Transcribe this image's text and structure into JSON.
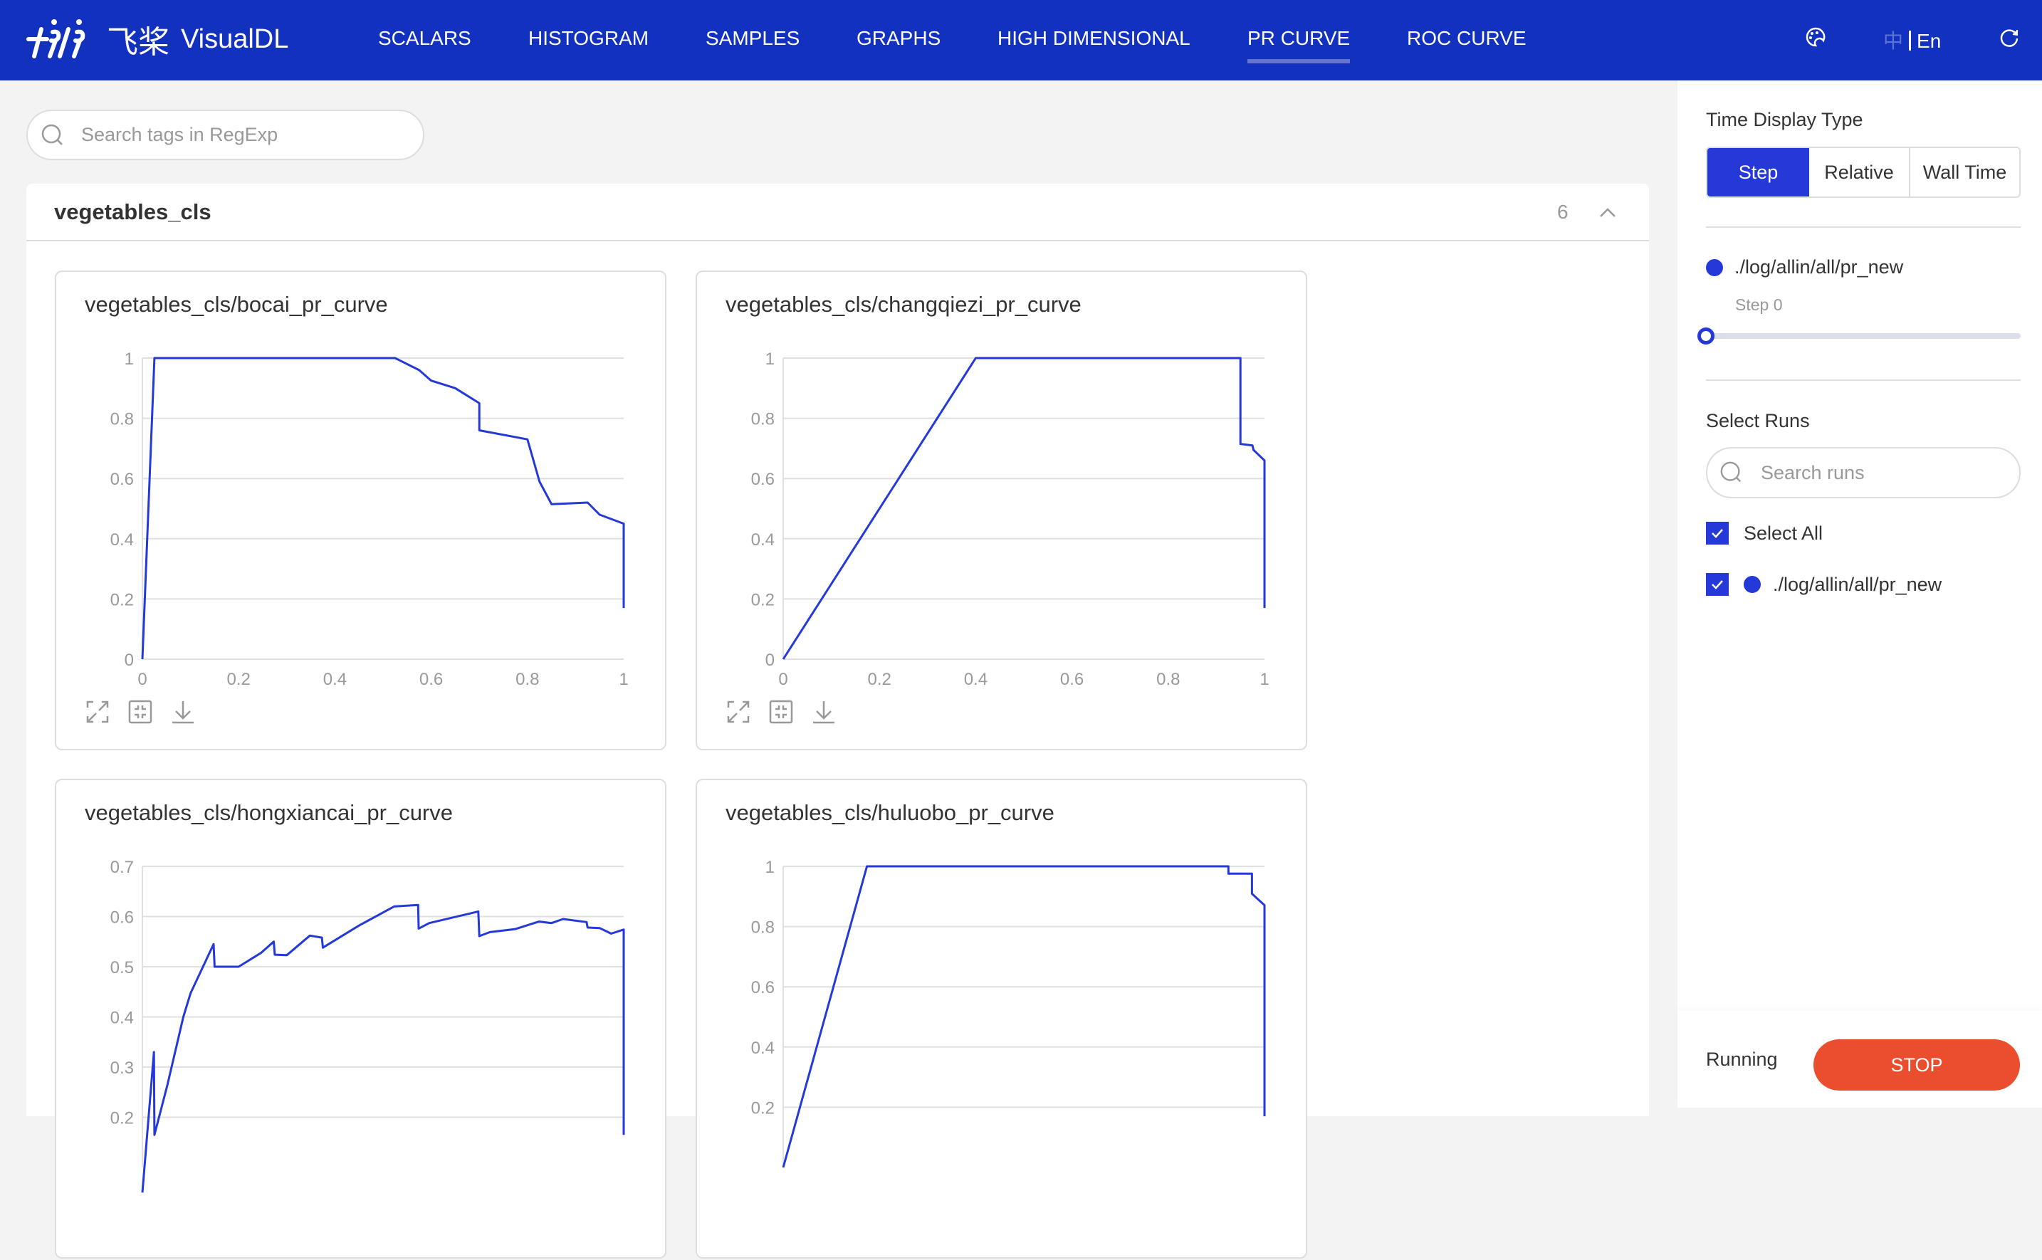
{
  "header": {
    "logo_mark": "⌿ƤƤ",
    "logo_cn": "飞桨",
    "app_name": "VisualDL",
    "nav": [
      {
        "label": "SCALARS",
        "active": false
      },
      {
        "label": "HISTOGRAM",
        "active": false
      },
      {
        "label": "SAMPLES",
        "active": false
      },
      {
        "label": "GRAPHS",
        "active": false
      },
      {
        "label": "HIGH DIMENSIONAL",
        "active": false
      },
      {
        "label": "PR CURVE",
        "active": true
      },
      {
        "label": "ROC CURVE",
        "active": false
      }
    ],
    "lang_cn": "中",
    "lang_en": "En",
    "icons": [
      "palette-icon",
      "refresh-icon"
    ]
  },
  "search": {
    "placeholder": "Search tags in RegExp",
    "value": ""
  },
  "section": {
    "title": "vegetables_cls",
    "count": "6"
  },
  "chart_data": [
    {
      "type": "line",
      "title": "vegetables_cls/bocai_pr_curve",
      "xlabel": "",
      "ylabel": "",
      "xlim": [
        0,
        1
      ],
      "ylim": [
        0,
        1
      ],
      "xticks": [
        "0",
        "0.2",
        "0.4",
        "0.6",
        "0.8",
        "1"
      ],
      "yticks": [
        "0",
        "0.2",
        "0.4",
        "0.6",
        "0.8",
        "1"
      ],
      "grid": true,
      "series": [
        {
          "name": "./log/allin/all/pr_new",
          "color": "#2439d8",
          "x": [
            0,
            0.025,
            0.525,
            0.575,
            0.6,
            0.65,
            0.7,
            0.7,
            0.8,
            0.825,
            0.85,
            0.925,
            0.95,
            1,
            1
          ],
          "y": [
            0,
            1,
            1,
            0.96,
            0.925,
            0.9,
            0.85,
            0.76,
            0.73,
            0.59,
            0.515,
            0.52,
            0.48,
            0.45,
            0.17
          ]
        }
      ]
    },
    {
      "type": "line",
      "title": "vegetables_cls/changqiezi_pr_curve",
      "xlabel": "",
      "ylabel": "",
      "xlim": [
        0,
        1
      ],
      "ylim": [
        0,
        1
      ],
      "xticks": [
        "0",
        "0.2",
        "0.4",
        "0.6",
        "0.8",
        "1"
      ],
      "yticks": [
        "0",
        "0.2",
        "0.4",
        "0.6",
        "0.8",
        "1"
      ],
      "grid": true,
      "series": [
        {
          "name": "./log/allin/all/pr_new",
          "color": "#2439d8",
          "x": [
            0,
            0.4,
            0.95,
            0.95,
            0.975,
            0.977,
            1,
            1
          ],
          "y": [
            0,
            1,
            1,
            0.715,
            0.71,
            0.695,
            0.66,
            0.17
          ]
        }
      ]
    },
    {
      "type": "line",
      "title": "vegetables_cls/hongxiancai_pr_curve",
      "xlabel": "",
      "ylabel": "",
      "xlim": [
        0,
        1
      ],
      "ylim": [
        0.1,
        0.7
      ],
      "xticks": [],
      "yticks": [
        "0.2",
        "0.3",
        "0.4",
        "0.5",
        "0.6",
        "0.7"
      ],
      "grid": true,
      "series": [
        {
          "name": "./log/allin/all/pr_new",
          "color": "#2439d8",
          "x": [
            0,
            0.024,
            0.025,
            0.052,
            0.085,
            0.1,
            0.148,
            0.15,
            0.2,
            0.247,
            0.273,
            0.275,
            0.3,
            0.348,
            0.373,
            0.375,
            0.45,
            0.523,
            0.573,
            0.574,
            0.596,
            0.698,
            0.7,
            0.722,
            0.775,
            0.824,
            0.85,
            0.874,
            0.923,
            0.925,
            0.95,
            0.974,
            1,
            1
          ],
          "y": [
            0.05,
            0.33,
            0.165,
            0.265,
            0.4,
            0.447,
            0.545,
            0.5,
            0.5,
            0.528,
            0.55,
            0.524,
            0.523,
            0.562,
            0.558,
            0.538,
            0.582,
            0.62,
            0.623,
            0.576,
            0.587,
            0.61,
            0.561,
            0.569,
            0.575,
            0.59,
            0.587,
            0.595,
            0.589,
            0.578,
            0.577,
            0.566,
            0.574,
            0.165
          ]
        }
      ]
    },
    {
      "type": "line",
      "title": "vegetables_cls/huluobo_pr_curve",
      "xlabel": "",
      "ylabel": "",
      "xlim": [
        0,
        1
      ],
      "ylim": [
        0,
        1
      ],
      "xticks": [],
      "yticks": [
        "0.2",
        "0.4",
        "0.6",
        "0.8",
        "1"
      ],
      "grid": true,
      "series": [
        {
          "name": "./log/allin/all/pr_new",
          "color": "#2439d8",
          "x": [
            0,
            0.174,
            0.925,
            0.925,
            0.974,
            0.974,
            1,
            1
          ],
          "y": [
            0,
            1,
            1,
            0.976,
            0.976,
            0.909,
            0.871,
            0.17
          ]
        }
      ]
    }
  ],
  "card_tools": [
    "maximize-icon",
    "restore-zoom-icon",
    "download-icon"
  ],
  "sidebar": {
    "time_display_label": "Time Display Type",
    "time_options": [
      {
        "label": "Step",
        "active": true
      },
      {
        "label": "Relative",
        "active": false
      },
      {
        "label": "Wall Time",
        "active": false
      }
    ],
    "run_name": "./log/allin/all/pr_new",
    "run_color": "#2439d8",
    "step_label": "Step 0",
    "step_progress": 0,
    "select_runs_label": "Select Runs",
    "search_runs_placeholder": "Search runs",
    "select_all_label": "Select All",
    "select_all_checked": true,
    "runs": [
      {
        "label": "./log/allin/all/pr_new",
        "checked": true,
        "color": "#2439d8"
      }
    ],
    "status": "Running",
    "stop_label": "STOP"
  }
}
